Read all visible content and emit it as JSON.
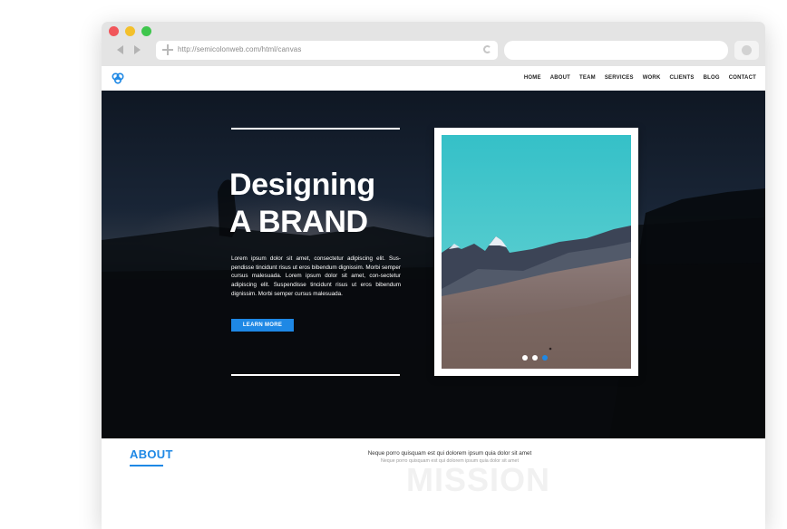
{
  "browser": {
    "url": "http://semicolonweb.com/html/canvas",
    "colors": {
      "close": "#f1565b",
      "minimize": "#f3c02b",
      "maximize": "#3fc64d"
    }
  },
  "site_nav": {
    "logo": "canvas-logo-icon",
    "menu": [
      "HOME",
      "ABOUT",
      "TEAM",
      "SERVICES",
      "WORK",
      "CLIENTS",
      "BLOG",
      "CONTACT"
    ]
  },
  "hero": {
    "title_line1": "Designing",
    "title_line2": "A BRAND",
    "body": "Lorem ipsum dolor sit amet, consectetur adipiscing elit. Sus-pendisse tincidunt risus ut eros bibendum dignissim. Morbi semper cursus malesuada. Lorem ipsum dolor sit amet, con-sectetur adipiscing elit. Suspendisse tincidunt risus ut eros bibendum dignissim. Morbi semper cursus malesuada.",
    "button_label": "LEARN MORE",
    "slider": {
      "slides": 3,
      "active_index": 2
    }
  },
  "about": {
    "title": "ABOUT",
    "tagline": "Neque porro quisquam est qui dolorem ipsum quia dolor sit amet",
    "subtitle": "Neque porro quisquam est qui dolorem ipsum quia dolor sit amet",
    "watermark": "MISSION"
  },
  "accent_color": "#1e88e5"
}
